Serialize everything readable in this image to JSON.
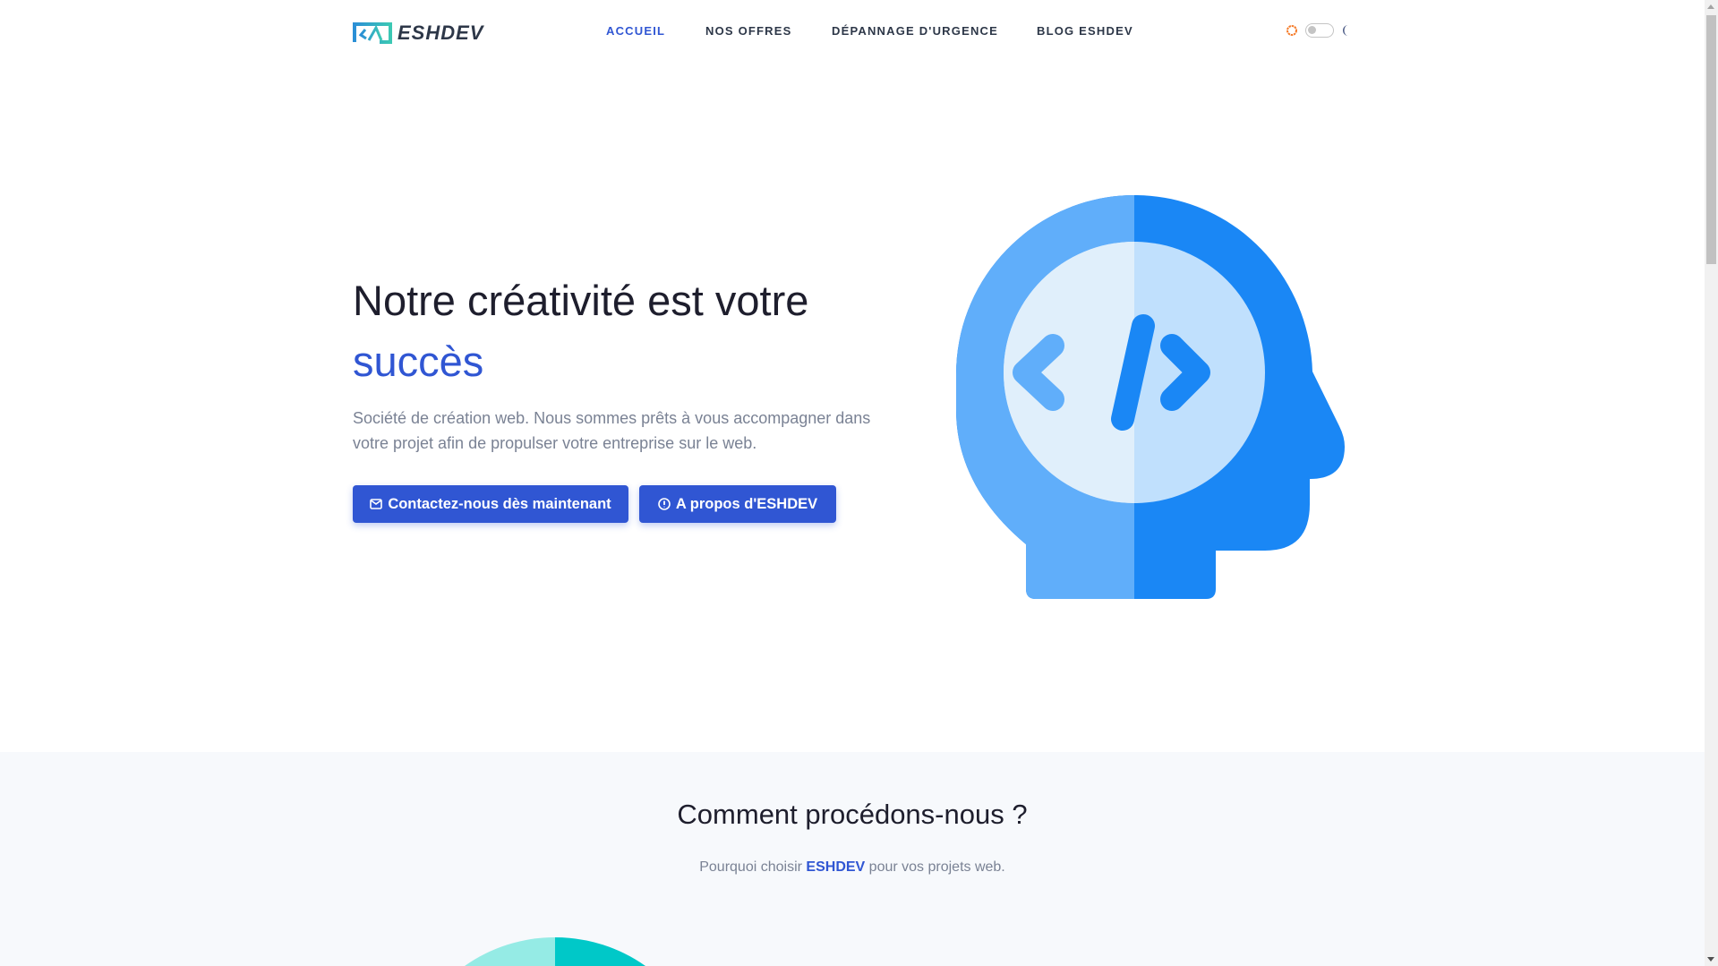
{
  "nav": {
    "logo_text": "ESHDEV",
    "items": [
      {
        "label": "ACCUEIL",
        "active": true
      },
      {
        "label": "NOS OFFRES"
      },
      {
        "label": "DÉPANNAGE D'URGENCE"
      },
      {
        "label": "BLOG ESHDEV"
      }
    ],
    "theme_toggle": {
      "icons": [
        "sun-icon",
        "moon-icon"
      ],
      "dark_mode": false
    }
  },
  "hero": {
    "title": "Notre créativité est votre",
    "title_accent": "succès",
    "text": "Société de création web. Nous sommes prêts à vous accompagner dans votre projet afin de propulser votre entreprise sur le web.",
    "btn_contact": "Contactez-nous dès maintenant",
    "btn_about": "A propos d'ESHDEV"
  },
  "section2": {
    "title": "Comment procédons-nous ?",
    "subtitle_pre": "Pourquoi choisir",
    "subtitle_brand": "ESHDEV",
    "subtitle_post": "pour vos projets web."
  },
  "colors": {
    "accent": "#3056d3",
    "head_light": "#60aefa",
    "head_dark": "#1a87f5",
    "teal": "#00c8c8"
  }
}
